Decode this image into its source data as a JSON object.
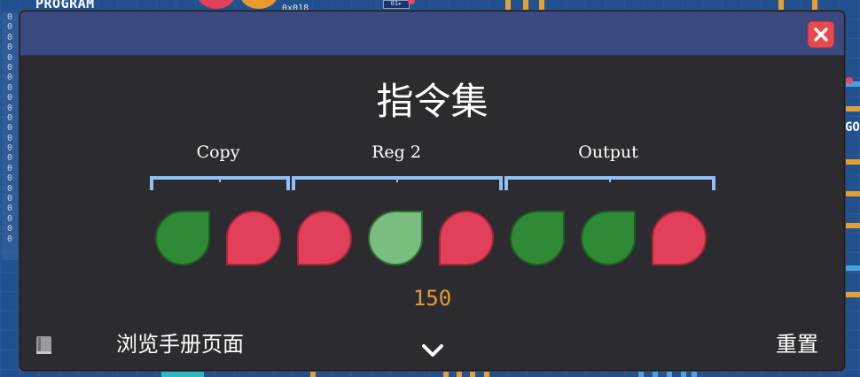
{
  "background": {
    "program_label": "PROGRAM",
    "top_text": "0x018",
    "chip_label": "01▸",
    "side_label": "GO",
    "zero_values": [
      "0",
      "0",
      "0",
      "0",
      "0",
      "0",
      "0",
      "0",
      "0",
      "0",
      "0",
      "0",
      "0",
      "0",
      "0",
      "0",
      "0",
      "0",
      "0",
      "0",
      "0",
      "0",
      "0"
    ]
  },
  "modal": {
    "title": "指令集",
    "groups": [
      {
        "label": "Copy"
      },
      {
        "label": "Reg 2"
      },
      {
        "label": "Output"
      }
    ],
    "bits": [
      {
        "state": "on",
        "shape": "leaf-left",
        "color": "#2e8a35"
      },
      {
        "state": "off",
        "shape": "leaf-right",
        "color": "#e2405a"
      },
      {
        "state": "off",
        "shape": "leaf-right",
        "color": "#e2405a"
      },
      {
        "state": "highlight",
        "shape": "leaf-left",
        "color": "#79be7f"
      },
      {
        "state": "off",
        "shape": "leaf-right",
        "color": "#e2405a"
      },
      {
        "state": "on",
        "shape": "leaf-left",
        "color": "#2e8a35"
      },
      {
        "state": "on",
        "shape": "leaf-left",
        "color": "#2e8a35"
      },
      {
        "state": "off",
        "shape": "leaf-right",
        "color": "#e2405a"
      }
    ],
    "value": "150",
    "footer": {
      "manual_label": "浏览手册页面",
      "manual_icon": "book-icon",
      "expand_icon": "chevron-down-icon",
      "reset_label": "重置"
    },
    "close_icon": "close-icon"
  },
  "colors": {
    "header": "#3b4981",
    "panel": "#2c2c30",
    "bracket": "#8ec0f5",
    "bit_on": "#2e8a35",
    "bit_off": "#e2405a",
    "bit_highlight": "#79be7f",
    "value": "#e39a3b",
    "close": "#e8484e"
  }
}
